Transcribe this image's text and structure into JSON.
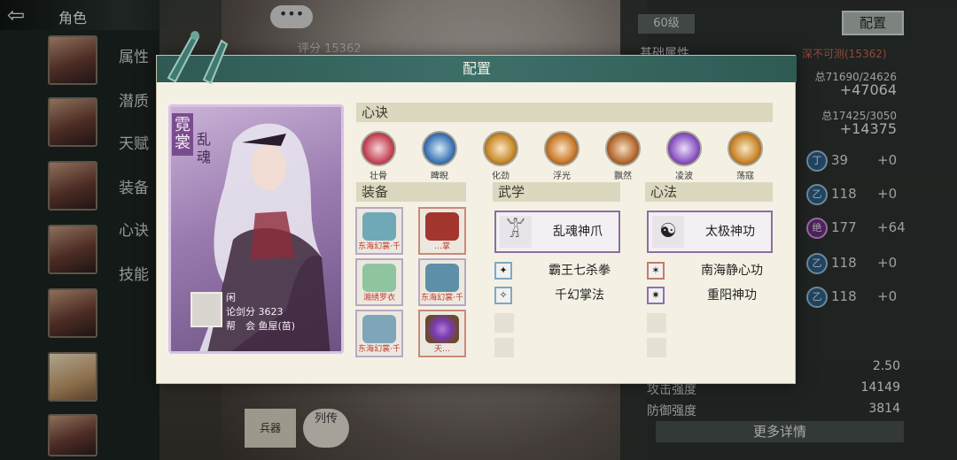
{
  "screen": {
    "title": "角色",
    "chat_icon": "•••",
    "score_strip": "评分 15362",
    "side_tabs": [
      "属性",
      "潜质",
      "天赋",
      "装备",
      "心诀",
      "技能"
    ],
    "level": "60级",
    "config_button": "配置",
    "basic_attr": "基础属性",
    "hidden_power": "深不可测(15362)",
    "totals": [
      {
        "line": "总71690/24626",
        "big": "+47064"
      },
      {
        "line": "总17425/3050",
        "big": "+14375"
      }
    ],
    "stat_rows": [
      {
        "gem": "丁",
        "value": "39",
        "add": "+0"
      },
      {
        "gem": "乙",
        "value": "118",
        "add": "+0"
      },
      {
        "gem": "绝",
        "value": "177",
        "add": "+64"
      },
      {
        "gem": "乙",
        "value": "118",
        "add": "+0"
      },
      {
        "gem": "乙",
        "value": "118",
        "add": "+0"
      }
    ],
    "bottom_stats": [
      {
        "label": "",
        "value": "2.50"
      },
      {
        "label": "攻击强度",
        "value": "14149"
      },
      {
        "label": "防御强度",
        "value": "3814"
      }
    ],
    "more_details": "更多详情",
    "bio_button": "列传",
    "gear_stand": "兵器"
  },
  "modal": {
    "title": "配置",
    "character": {
      "name": "霓裳",
      "sect": "乱魂",
      "player_name": "闲",
      "score_line": "论剑分 3623",
      "guild_line": "帮　会 鱼屋(苗)"
    },
    "xinjue": {
      "header": "心诀",
      "skills": [
        {
          "label": "壮骨",
          "color": "#c6485a"
        },
        {
          "label": "睥睨",
          "color": "#3f78b6"
        },
        {
          "label": "化劲",
          "color": "#c98a2a"
        },
        {
          "label": "浮光",
          "color": "#c97a2a"
        },
        {
          "label": "飘然",
          "color": "#b56a2e"
        },
        {
          "label": "凌波",
          "color": "#8b55c4"
        },
        {
          "label": "荡寇",
          "color": "#c9862a"
        }
      ]
    },
    "equipment": {
      "header": "装备",
      "items": [
        {
          "label": "东海幻裳·千",
          "color": "#6fa9b8"
        },
        {
          "label": "…掌",
          "color": "#a3362e"
        },
        {
          "label": "湘绣罗衣",
          "color": "#8fc4a0"
        },
        {
          "label": "东海幻裳·千",
          "color": "#5d8fa8"
        },
        {
          "label": "东海幻裳·千",
          "color": "#7ea6b8"
        },
        {
          "label": "天…",
          "color": "#7a3bb0"
        }
      ]
    },
    "wuxue": {
      "header": "武学",
      "main": {
        "name": "乱魂神爪",
        "icon": "𓀠"
      },
      "subs": [
        {
          "name": "霸王七杀拳",
          "icon": "✦"
        },
        {
          "name": "千幻掌法",
          "icon": "✧"
        }
      ]
    },
    "xinfa": {
      "header": "心法",
      "main": {
        "name": "太极神功",
        "icon": "☯"
      },
      "subs": [
        {
          "name": "南海静心功",
          "icon": "✶"
        },
        {
          "name": "重阳神功",
          "icon": "✷"
        }
      ]
    }
  }
}
